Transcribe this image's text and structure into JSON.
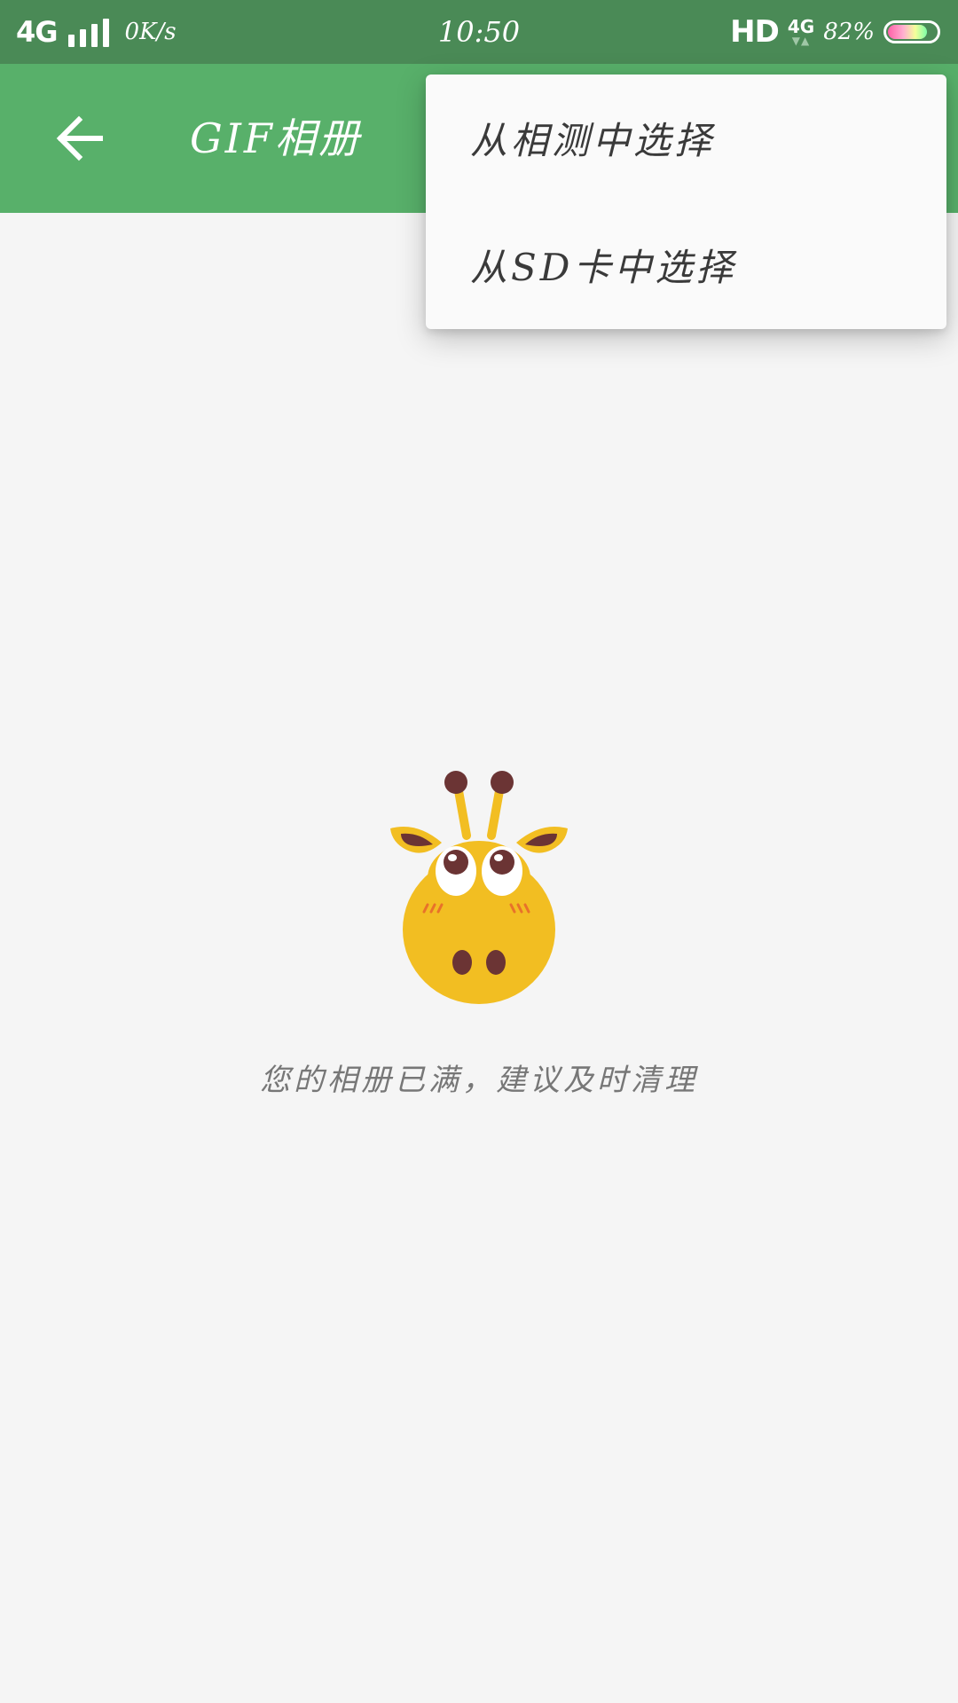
{
  "status_bar": {
    "network": "4G",
    "net_speed": "0K/s",
    "time": "10:50",
    "hd": "HD",
    "network_small": "4G",
    "battery_percent": "82%",
    "battery_level": 0.82,
    "background_color": "#4a8a56"
  },
  "app_bar": {
    "back_icon": "arrow-left-icon",
    "title": "GIF相册",
    "background_color": "#58b06a"
  },
  "menu": {
    "items": [
      {
        "label": "从相测中选择"
      },
      {
        "label": "从SD卡中选择"
      }
    ]
  },
  "empty_state": {
    "illustration": "giraffe-icon",
    "message": "您的相册已满，建议及时清理"
  }
}
